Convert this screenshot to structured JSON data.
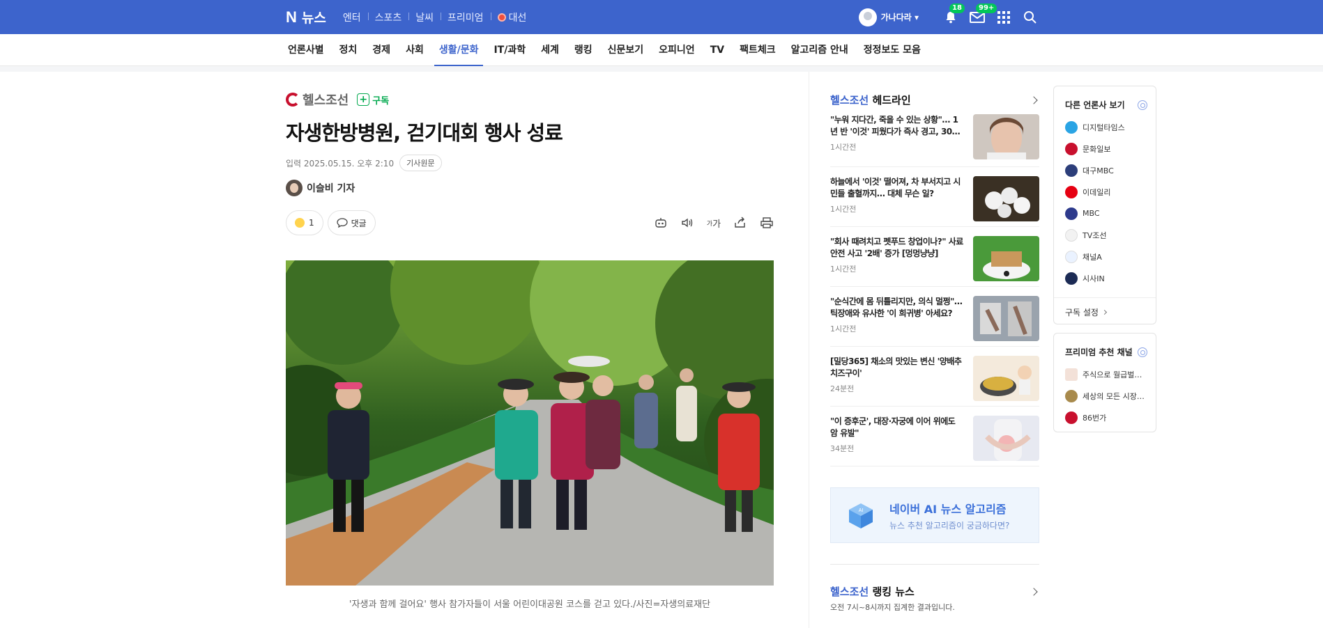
{
  "header": {
    "logo": "N",
    "title": "뉴스",
    "nav": [
      "엔터",
      "스포츠",
      "날씨",
      "프리미엄",
      "대선"
    ],
    "username": "가나다라",
    "notif_count": "18",
    "mail_count": "99+"
  },
  "sections": [
    "언론사별",
    "정치",
    "경제",
    "사회",
    "생활/문화",
    "IT/과학",
    "세계",
    "랭킹",
    "신문보기",
    "오피니언",
    "TV",
    "팩트체크",
    "알고리즘 안내",
    "정정보도 모음"
  ],
  "active_section": "생활/문화",
  "article": {
    "press_name": "헬스조선",
    "subscribe_label": "구독",
    "title": "자생한방병원, 걷기대회 행사 성료",
    "date": "입력 2025.05.15. 오후 2:10",
    "original_label": "기사원문",
    "reporter": "이슬비 기자",
    "reaction_count": "1",
    "comment_label": "댓글",
    "font_size_label": "가",
    "caption": "'자생과 함께 걸어요' 행사 참가자들이 서울 어린이대공원 코스를 걷고 있다./사진=자생의료재단"
  },
  "headlines": {
    "press": "헬스조선",
    "label": "헤드라인",
    "items": [
      {
        "title": "\"누워 지다간, 죽을 수 있는 상황\"… 1년 반 '이것' 피웠다가 즉사 경고, 30…",
        "time": "1시간전"
      },
      {
        "title": "하늘에서 '이것' 떨어져, 차 부서지고 시민들 출혈까지… 대체 무슨 일?",
        "time": "1시간전"
      },
      {
        "title": "\"회사 때려치고 펫푸드 창업이나?\" 사료 안전 사고 '2배' 증가 [멍멍냥냥]",
        "time": "1시간전"
      },
      {
        "title": "\"순식간에 몸 뒤틀리지만, 의식 멀쩡\"… 틱장애와 유사한 '이 희귀병' 아세요?",
        "time": "1시간전"
      },
      {
        "title": "[밀당365] 채소의 맛있는 변신 '양배추 치즈구이'",
        "time": "24분전"
      },
      {
        "title": "\"이 증후군', 대장·자궁에 이어 위에도 암 유발\"",
        "time": "34분전"
      }
    ]
  },
  "ai_banner": {
    "title": "네이버 AI 뉴스 알고리즘",
    "subtitle": "뉴스 추천 알고리즘이 궁금하다면?"
  },
  "ranking": {
    "press": "헬스조선",
    "label": "랭킹 뉴스",
    "subtitle": "오전 7시~8시까지 집계한 결과입니다."
  },
  "other_press": {
    "title": "다른 언론사 보기",
    "items": [
      "디지털타임스",
      "문화일보",
      "대구MBC",
      "이데일리",
      "MBC",
      "TV조선",
      "채널A",
      "시사IN"
    ],
    "colors": [
      "#2aa4e4",
      "#c8102e",
      "#2c3e7a",
      "#e60012",
      "#2d3a8c",
      "#f2f2f2",
      "#eaf2ff",
      "#1c2b55"
    ],
    "subscribe_setting": "구독 설정"
  },
  "premium": {
    "title": "프리미엄 추천 채널",
    "items": [
      "주식으로 월급벌…",
      "세상의 모든 시장…",
      "86번가"
    ]
  }
}
